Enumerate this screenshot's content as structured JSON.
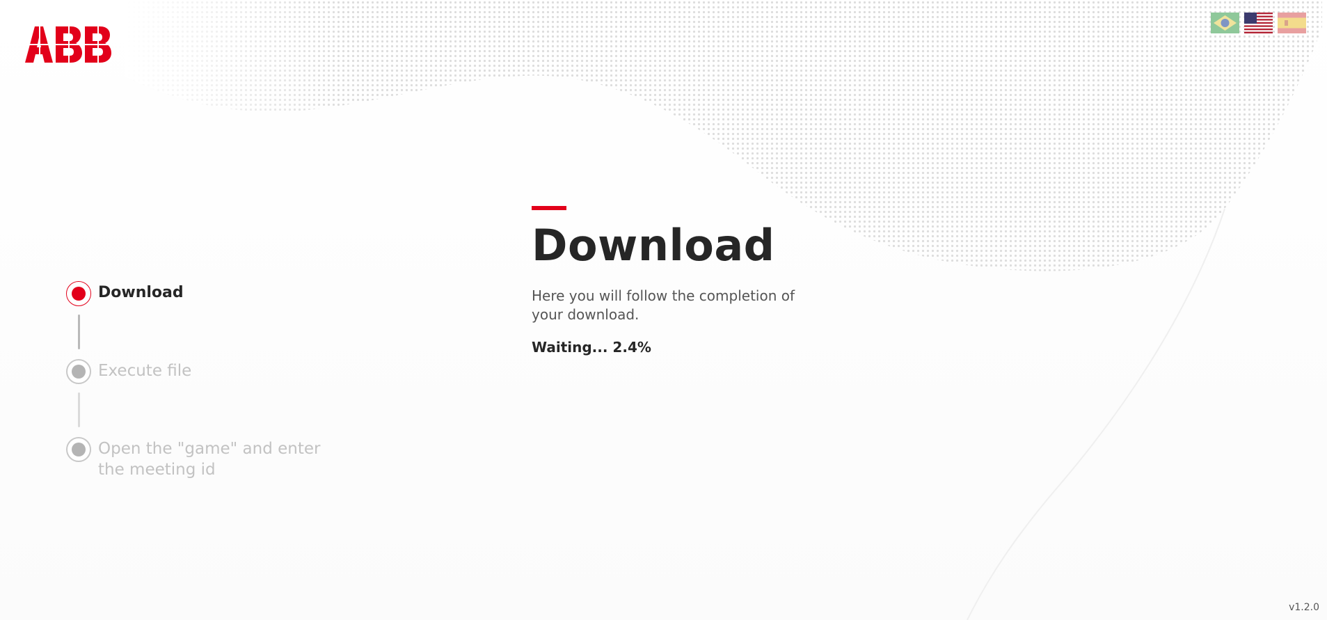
{
  "brand": {
    "logo_text": "ABB",
    "accent_color": "#e2001a"
  },
  "languages": [
    {
      "name": "Brazil flag",
      "icon": "flag-brazil-icon"
    },
    {
      "name": "United States flag",
      "icon": "flag-usa-icon"
    },
    {
      "name": "Spain flag",
      "icon": "flag-spain-icon"
    }
  ],
  "steps": [
    {
      "label": "Download",
      "state": "active"
    },
    {
      "label": "Execute file",
      "state": "pending"
    },
    {
      "label": "Open the \"game\" and enter the meeting id",
      "state": "pending"
    }
  ],
  "main": {
    "title": "Download",
    "description": "Here you will follow the completion of your download.",
    "status": "Waiting... 2.4%"
  },
  "footer": {
    "version": "v1.2.0"
  }
}
